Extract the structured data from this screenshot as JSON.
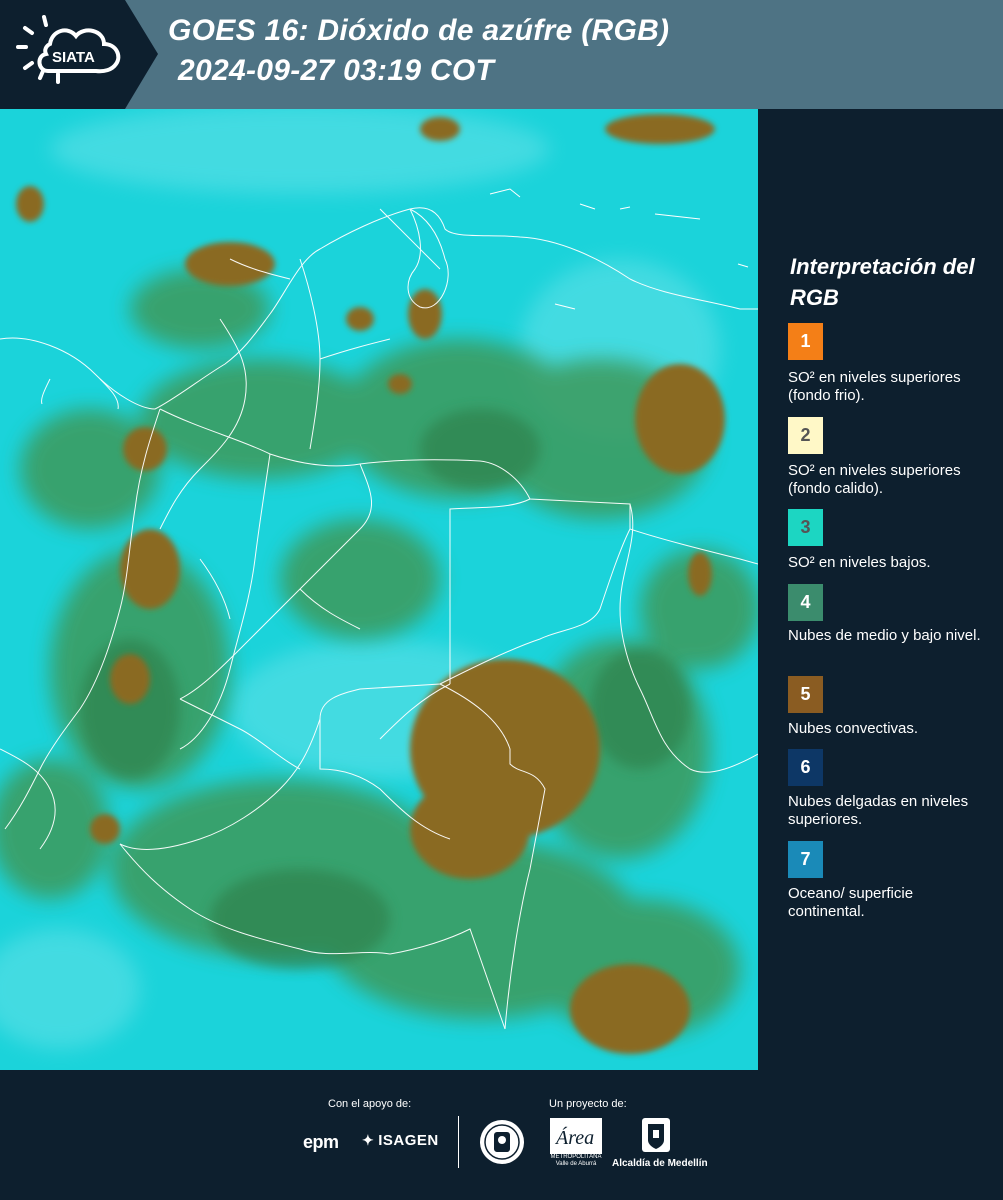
{
  "header": {
    "logo_text": "SIATA",
    "title_line1": "GOES 16: Dióxido de azúfre (RGB)",
    "title_line2": "2024-09-27 03:19 COT"
  },
  "legend": {
    "title": "Interpretación del RGB",
    "items": [
      {
        "number": "1",
        "color": "#f47f17",
        "number_color": "#ffffff",
        "label": "SO² en niveles superiores (fondo frio)."
      },
      {
        "number": "2",
        "color": "#fff8c7",
        "number_color": "#555555",
        "label": "SO² en niveles superiores (fondo calido)."
      },
      {
        "number": "3",
        "color": "#1cd6c2",
        "number_color": "#555555",
        "label": "SO² en niveles bajos."
      },
      {
        "number": "4",
        "color": "#3b8c6d",
        "number_color": "#ffffff",
        "label": "Nubes de medio y bajo nivel."
      },
      {
        "number": "5",
        "color": "#8a5c22",
        "number_color": "#ffffff",
        "label": "Nubes convectivas."
      },
      {
        "number": "6",
        "color": "#0d3766",
        "number_color": "#ffffff",
        "label": "Nubes delgadas en niveles superiores."
      },
      {
        "number": "7",
        "color": "#1a8ab8",
        "number_color": "#ffffff",
        "label": "Oceano/ superficie continental."
      }
    ]
  },
  "footer": {
    "support_label": "Con el apoyo de:",
    "project_label": "Un proyecto de:",
    "sponsor1": "epm",
    "sponsor2": "ISAGEN",
    "metro_label": "METROPOLITANA Valle de Aburrá",
    "alcaldia": "Alcaldía de Medellín"
  },
  "colors": {
    "header_bg": "#4e7384",
    "panel_bg": "#0d1f2e",
    "map_cyan": "#1bd3da",
    "map_green": "#3d9a5c",
    "map_brown": "#8a6a24"
  }
}
